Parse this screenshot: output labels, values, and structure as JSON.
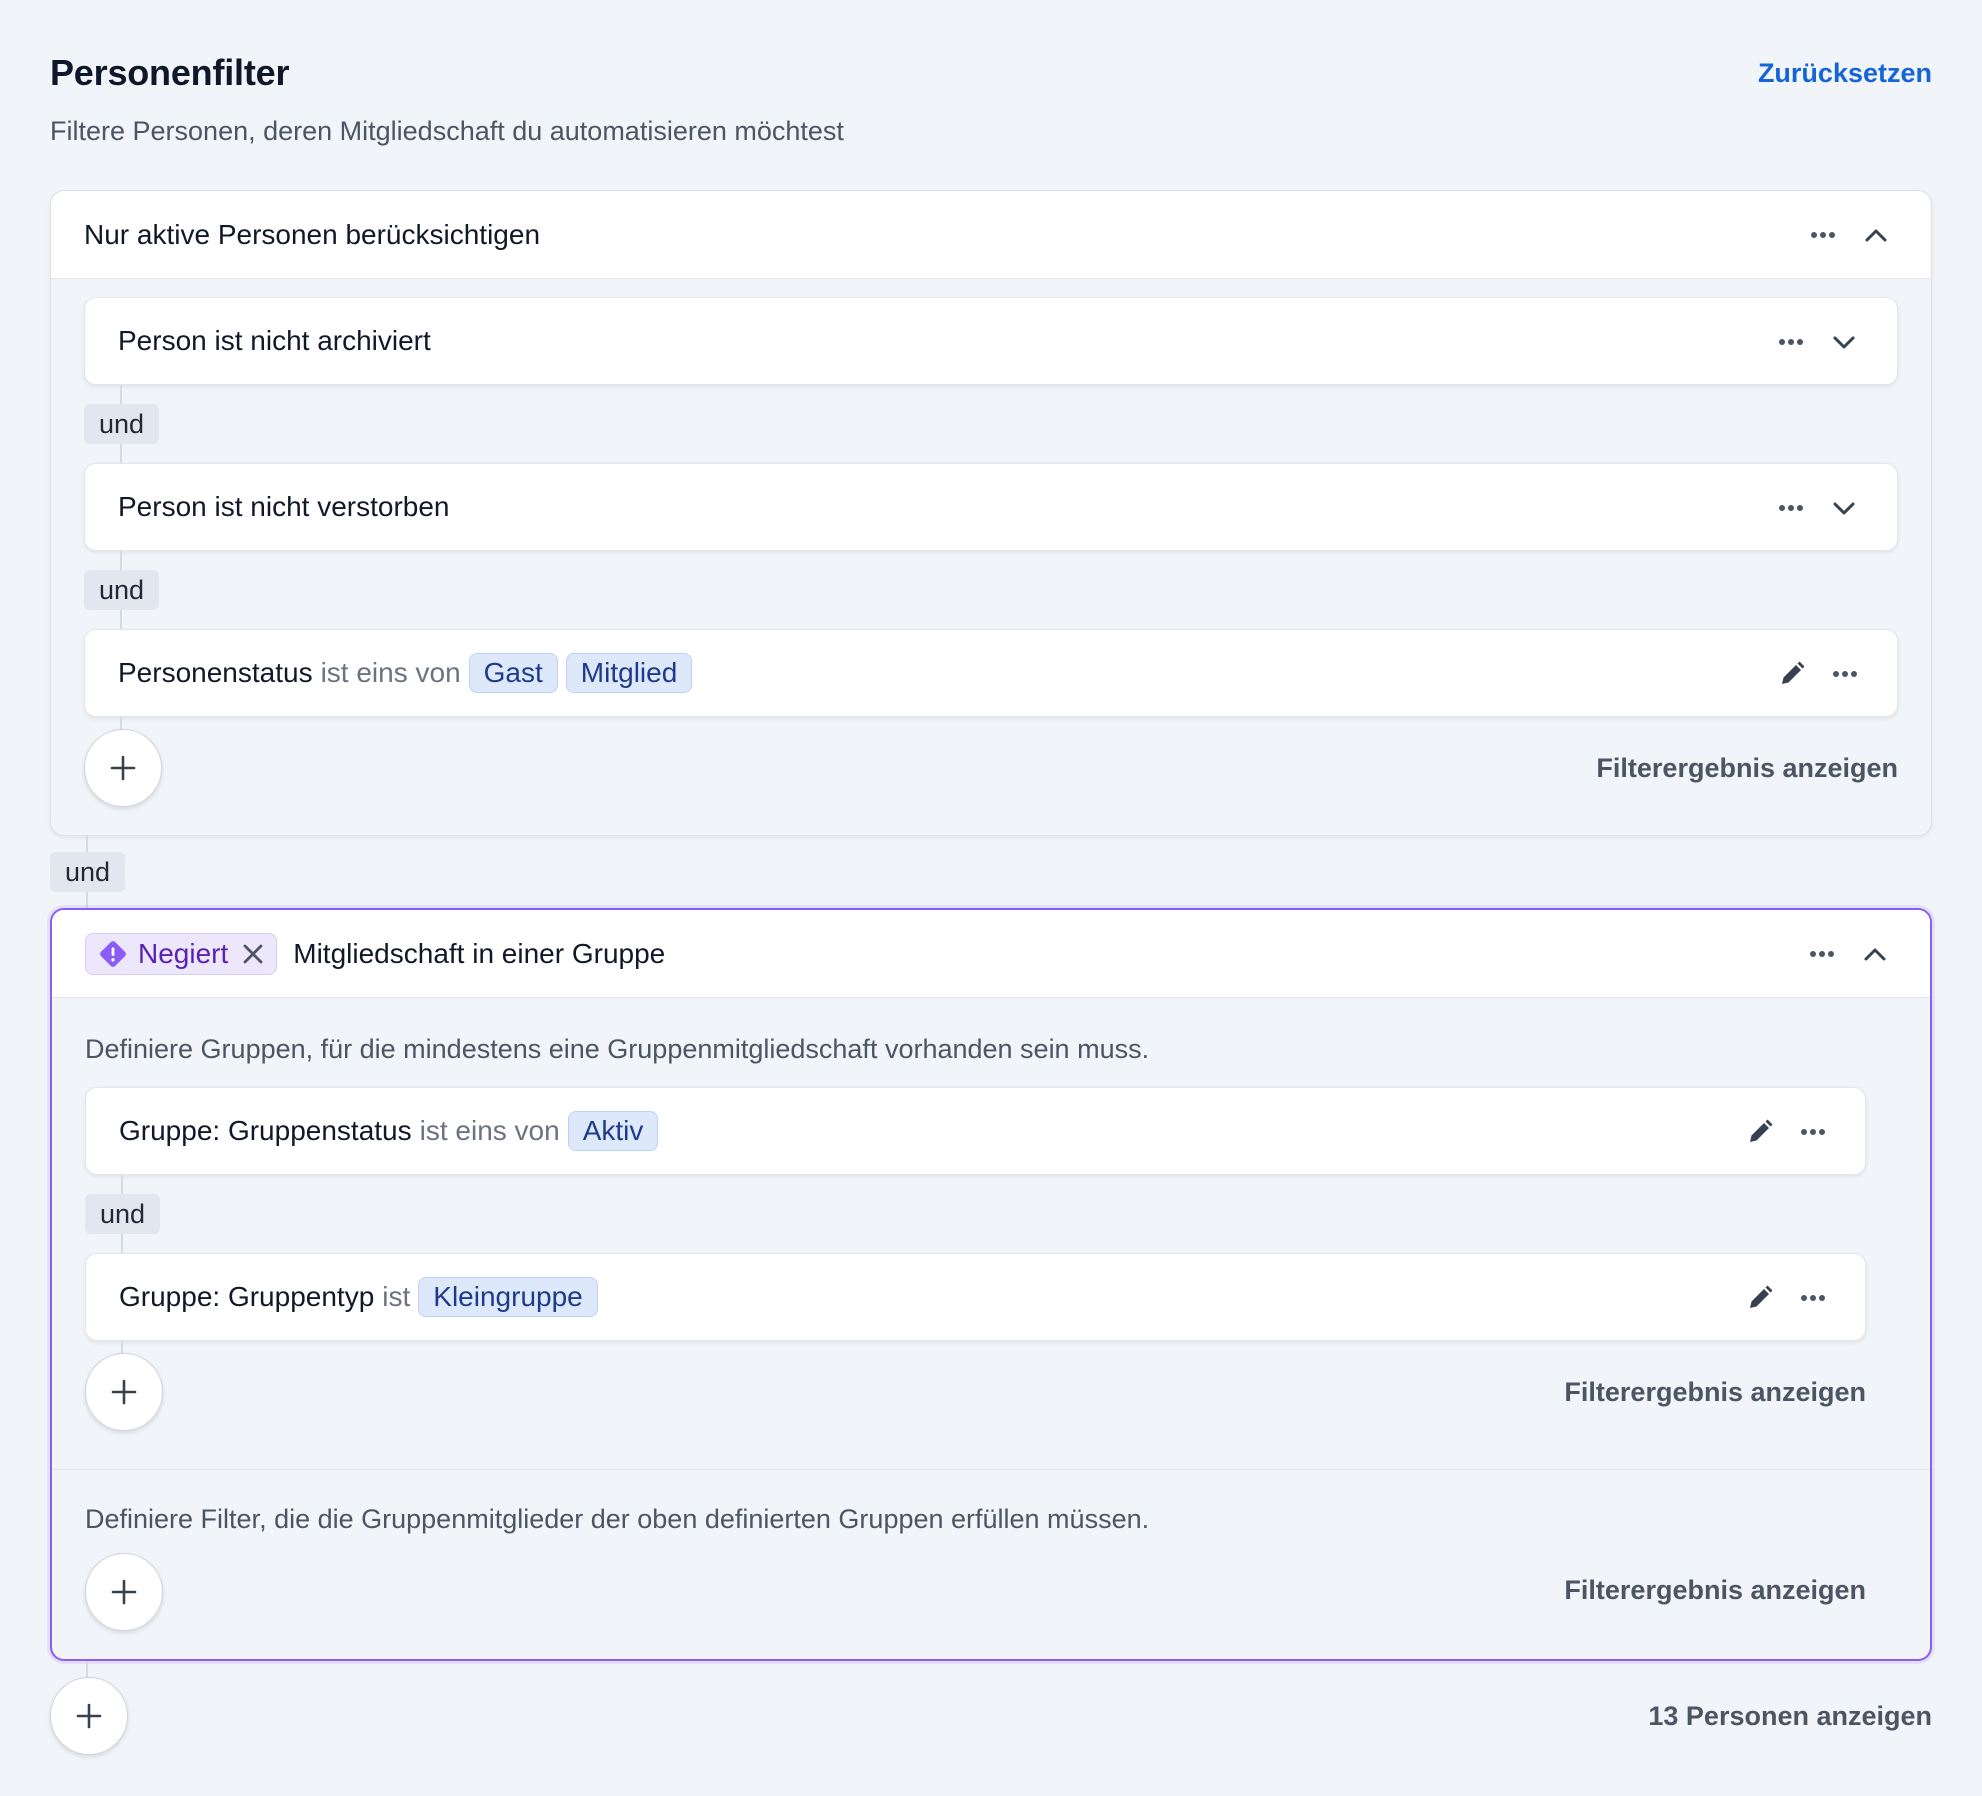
{
  "header": {
    "title": "Personenfilter",
    "subtitle": "Filtere Personen, deren Mitgliedschaft du automatisieren möchtest",
    "reset_label": "Zurücksetzen"
  },
  "group1": {
    "title": "Nur aktive Personen berücksichtigen",
    "cards": [
      {
        "label": "Person ist nicht archiviert"
      },
      {
        "label": "Person ist nicht verstorben"
      },
      {
        "field": "Personenstatus",
        "operator": "ist eins von",
        "values": [
          "Gast",
          "Mitglied"
        ]
      }
    ],
    "connector": "und",
    "result_label": "Filterergebnis anzeigen"
  },
  "between_connector": "und",
  "group2": {
    "badge_label": "Negiert",
    "title": "Mitgliedschaft in einer Gruppe",
    "section1_desc": "Definiere Gruppen, für die mindestens eine Gruppenmitgliedschaft vorhanden sein muss.",
    "cards": [
      {
        "field": "Gruppe: Gruppenstatus",
        "operator": "ist eins von",
        "values": [
          "Aktiv"
        ]
      },
      {
        "field": "Gruppe: Gruppentyp",
        "operator": "ist",
        "values": [
          "Kleingruppe"
        ]
      }
    ],
    "connector": "und",
    "section1_result_label": "Filterergebnis anzeigen",
    "section2_desc": "Definiere Filter, die die Gruppenmitglieder der oben definierten Gruppen erfüllen müssen.",
    "section2_result_label": "Filterergebnis anzeigen"
  },
  "footer": {
    "show_label": "13 Personen anzeigen"
  },
  "colors": {
    "accent": "#1565d8",
    "negated_border": "#8b5cf6",
    "chip_bg": "#dde9fb",
    "background": "#f1f4f8"
  }
}
